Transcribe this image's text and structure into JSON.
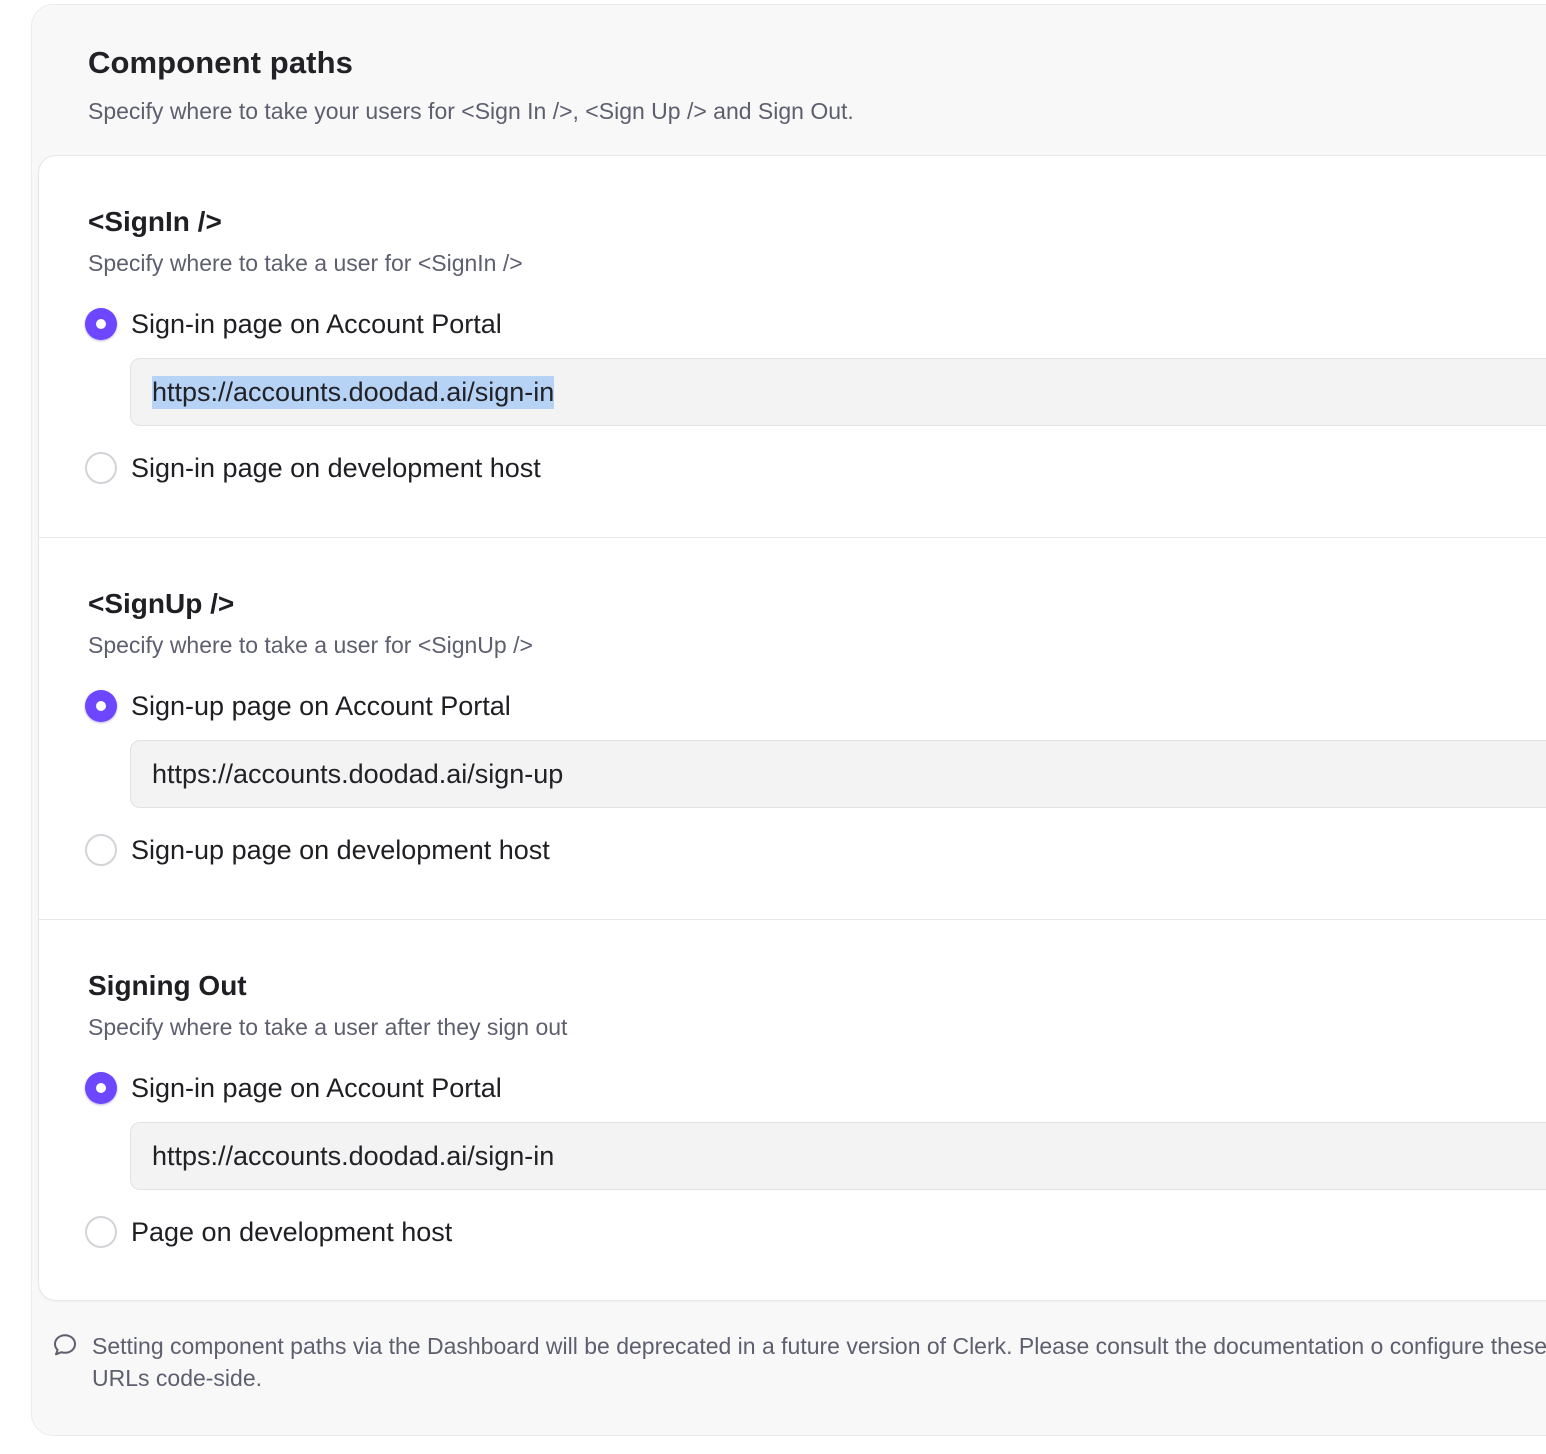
{
  "header": {
    "title": "Component paths",
    "subtitle": "Specify where to take your users for <Sign In />, <Sign Up /> and Sign Out."
  },
  "sections": [
    {
      "title": "<SignIn />",
      "description": "Specify where to take a user for <SignIn />",
      "options": [
        {
          "label": "Sign-in page on Account Portal",
          "selected": true
        },
        {
          "label": "Sign-in page on development host",
          "selected": false
        }
      ],
      "url_value": "https://accounts.doodad.ai/sign-in",
      "url_text_highlighted": true
    },
    {
      "title": "<SignUp />",
      "description": "Specify where to take a user for <SignUp />",
      "options": [
        {
          "label": "Sign-up page on Account Portal",
          "selected": true
        },
        {
          "label": "Sign-up page on development host",
          "selected": false
        }
      ],
      "url_value": "https://accounts.doodad.ai/sign-up",
      "url_text_highlighted": false
    },
    {
      "title": "Signing Out",
      "description": "Specify where to take a user after they sign out",
      "options": [
        {
          "label": "Sign-in page on Account Portal",
          "selected": true
        },
        {
          "label": "Page on development host",
          "selected": false
        }
      ],
      "url_value": "https://accounts.doodad.ai/sign-in",
      "url_text_highlighted": false
    }
  ],
  "notice": {
    "icon": "message-bubble-icon",
    "text": "Setting component paths via the Dashboard will be deprecated in a future version of Clerk. Please consult the documentation o configure these URLs code-side."
  },
  "colors": {
    "accent": "#6c47ff",
    "selection_highlight": "#b6d3f6",
    "muted_text": "#5e5f6e"
  }
}
